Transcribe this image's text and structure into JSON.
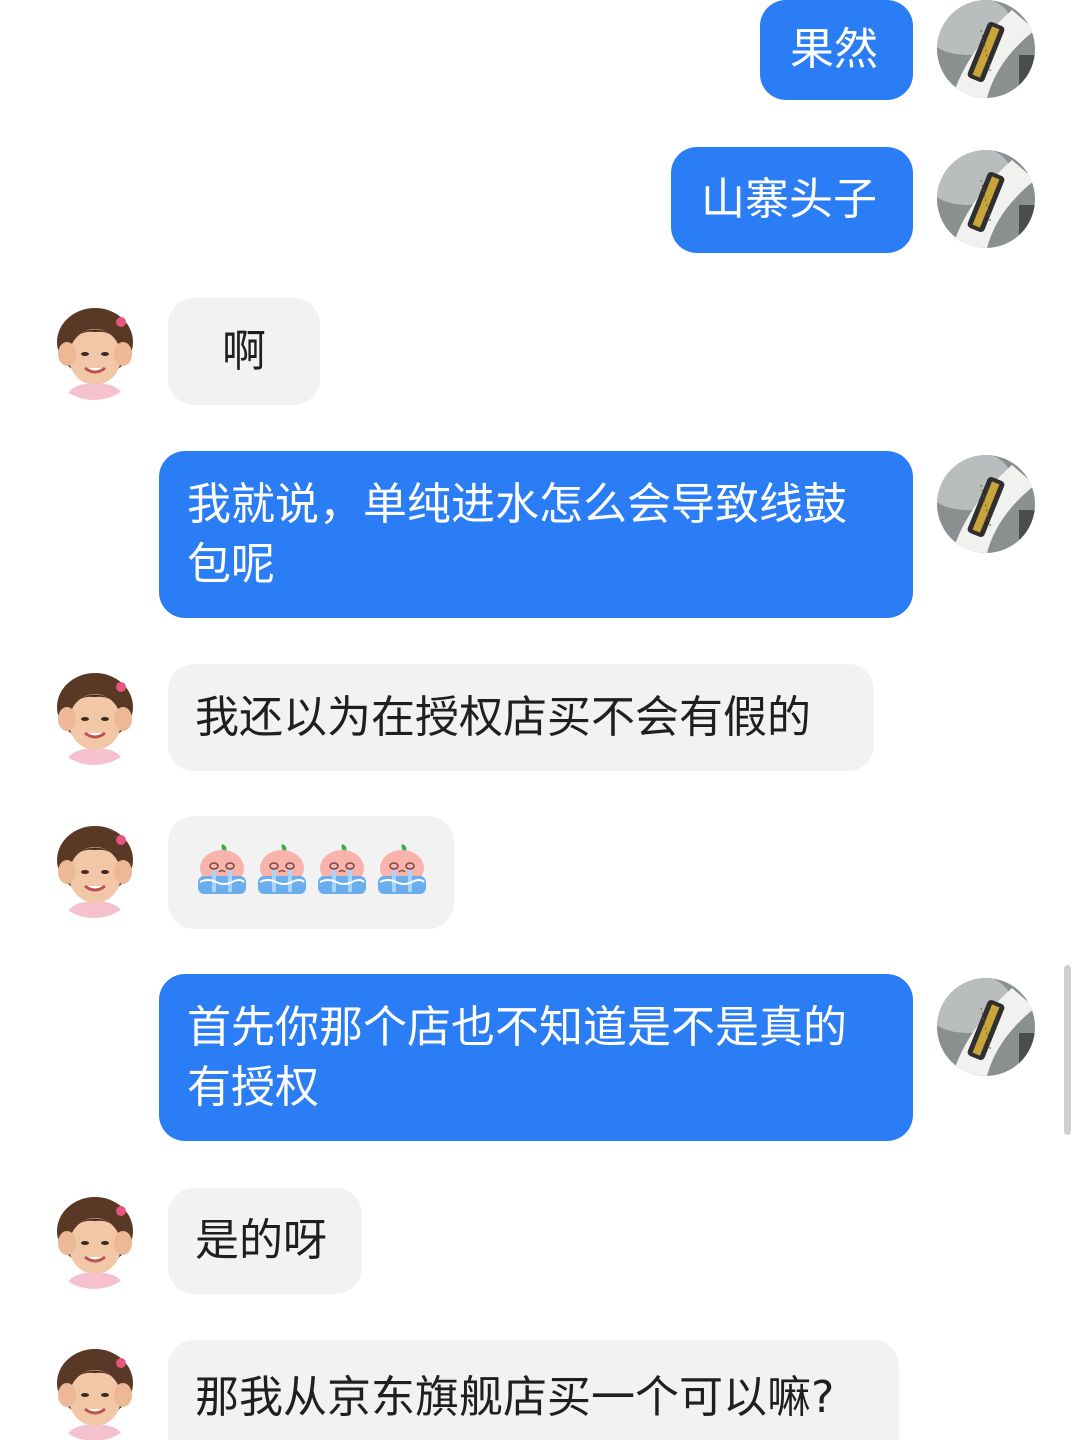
{
  "messages": [
    {
      "side": "out",
      "text": "果然"
    },
    {
      "side": "out",
      "text": "山寨头子"
    },
    {
      "side": "in",
      "text": "啊"
    },
    {
      "side": "out",
      "text": "我就说，单纯进水怎么会导致线鼓包呢"
    },
    {
      "side": "in",
      "text": "我还以为在授权店买不会有假的"
    },
    {
      "side": "in",
      "sticker": "crying-peach-emoji",
      "count": 4
    },
    {
      "side": "out",
      "text": "首先你那个店也不知道是不是真的有授权"
    },
    {
      "side": "in",
      "text": "是的呀"
    },
    {
      "side": "in",
      "text": "那我从京东旗舰店买一个可以嘛?"
    }
  ],
  "avatars": {
    "self": "usb-cable-avatar",
    "contact": "girl-avatar"
  },
  "colors": {
    "outgoing_bubble": "#2b7df5",
    "incoming_bubble": "#f2f2f2",
    "outgoing_text": "#ffffff",
    "incoming_text": "#1f1f1f"
  }
}
